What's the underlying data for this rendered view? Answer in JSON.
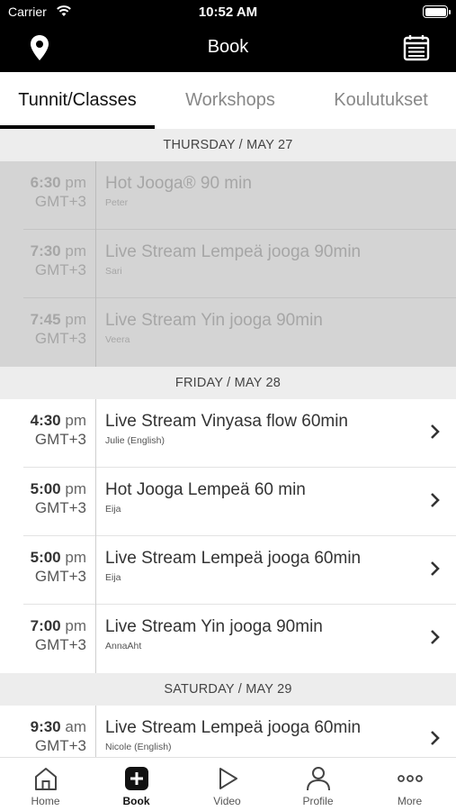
{
  "status_bar": {
    "carrier": "Carrier",
    "time": "10:52 AM"
  },
  "nav": {
    "title": "Book",
    "left_icon": "location-pin-icon",
    "right_icon": "calendar-icon"
  },
  "tabs": [
    {
      "label": "Tunnit/Classes",
      "active": true
    },
    {
      "label": "Workshops",
      "active": false
    },
    {
      "label": "Koulutukset",
      "active": false
    }
  ],
  "days": [
    {
      "header": "THURSDAY / MAY 27",
      "past": true,
      "classes": [
        {
          "time": "6:30",
          "ampm": "pm",
          "tz": "GMT+3",
          "name": "Hot Jooga® 90 min",
          "instructor": "Peter"
        },
        {
          "time": "7:30",
          "ampm": "pm",
          "tz": "GMT+3",
          "name": "Live Stream Lempeä jooga 90min",
          "instructor": "Sari"
        },
        {
          "time": "7:45",
          "ampm": "pm",
          "tz": "GMT+3",
          "name": "Live Stream Yin jooga 90min",
          "instructor": "Veera"
        }
      ]
    },
    {
      "header": "FRIDAY / MAY 28",
      "past": false,
      "classes": [
        {
          "time": "4:30",
          "ampm": "pm",
          "tz": "GMT+3",
          "name": "Live Stream Vinyasa flow 60min",
          "instructor": "Julie (English)"
        },
        {
          "time": "5:00",
          "ampm": "pm",
          "tz": "GMT+3",
          "name": "Hot Jooga Lempeä 60 min",
          "instructor": "Eija"
        },
        {
          "time": "5:00",
          "ampm": "pm",
          "tz": "GMT+3",
          "name": "Live Stream Lempeä jooga 60min",
          "instructor": "Eija"
        },
        {
          "time": "7:00",
          "ampm": "pm",
          "tz": "GMT+3",
          "name": "Live Stream Yin jooga 90min",
          "instructor": "AnnaAht"
        }
      ]
    },
    {
      "header": "SATURDAY / MAY 29",
      "past": false,
      "classes": [
        {
          "time": "9:30",
          "ampm": "am",
          "tz": "GMT+3",
          "name": "Live Stream Lempeä jooga 60min",
          "instructor": "Nicole (English)"
        }
      ]
    }
  ],
  "tabbar": [
    {
      "label": "Home",
      "icon": "home-icon",
      "active": false
    },
    {
      "label": "Book",
      "icon": "plus-square-icon",
      "active": true
    },
    {
      "label": "Video",
      "icon": "play-icon",
      "active": false
    },
    {
      "label": "Profile",
      "icon": "person-icon",
      "active": false
    },
    {
      "label": "More",
      "icon": "more-dots-icon",
      "active": false
    }
  ]
}
